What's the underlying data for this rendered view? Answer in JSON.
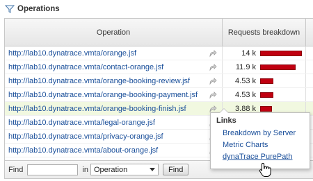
{
  "panel": {
    "title": "Operations",
    "icon": "filter-icon"
  },
  "table": {
    "columns": [
      "Operation",
      "Requests breakdown"
    ],
    "rows": [
      {
        "operation": "http://lab10.dynatrace.vmta/orange.jsf",
        "requests": "14 k",
        "fraction": 1.0
      },
      {
        "operation": "http://lab10.dynatrace.vmta/contact-orange.jsf",
        "requests": "11.9 k",
        "fraction": 0.85
      },
      {
        "operation": "http://lab10.dynatrace.vmta/orange-booking-review.jsf",
        "requests": "4.53 k",
        "fraction": 0.32
      },
      {
        "operation": "http://lab10.dynatrace.vmta/orange-booking-payment.jsf",
        "requests": "4.53 k",
        "fraction": 0.32
      },
      {
        "operation": "http://lab10.dynatrace.vmta/orange-booking-finish.jsf",
        "requests": "3.88 k",
        "fraction": 0.28,
        "selected": true
      },
      {
        "operation": "http://lab10.dynatrace.vmta/legal-orange.jsf",
        "requests": "",
        "fraction": 0
      },
      {
        "operation": "http://lab10.dynatrace.vmta/privacy-orange.jsf",
        "requests": "",
        "fraction": 0
      },
      {
        "operation": "http://lab10.dynatrace.vmta/about-orange.jsf",
        "requests": "",
        "fraction": 0
      }
    ]
  },
  "footer": {
    "find_label": "Find",
    "find_value": "",
    "in_label": "in",
    "select_value": "Operation",
    "find_button": "Find"
  },
  "popup": {
    "title": "Links",
    "items": [
      "Breakdown by Server",
      "Metric Charts",
      "dynaTrace PurePath"
    ],
    "hovered_index": 2
  },
  "colors": {
    "bar": "#c00010",
    "link": "#1a4f9a",
    "selected_row": "#f1f8e0"
  }
}
